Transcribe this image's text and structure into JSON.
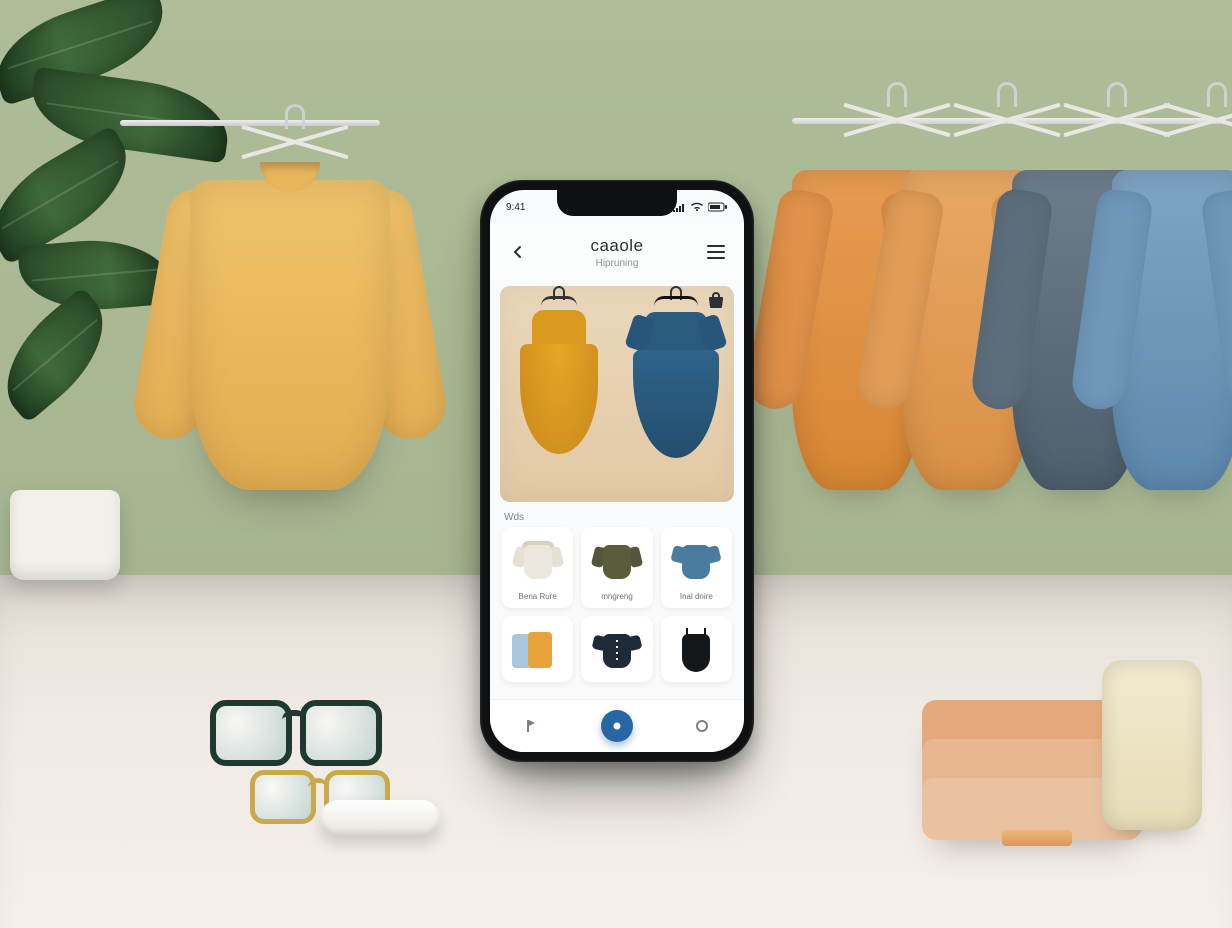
{
  "status": {
    "time": "9:41"
  },
  "header": {
    "title": "caaole",
    "subtitle": "Hipruning"
  },
  "hero": {
    "items": [
      {
        "name": "yellow-dress"
      },
      {
        "name": "blue-dress"
      }
    ]
  },
  "section_label": "Wds",
  "grid": {
    "row1": [
      {
        "caption": "Bena Rure"
      },
      {
        "caption": "mngreng"
      },
      {
        "caption": "Inal dnire"
      }
    ]
  }
}
